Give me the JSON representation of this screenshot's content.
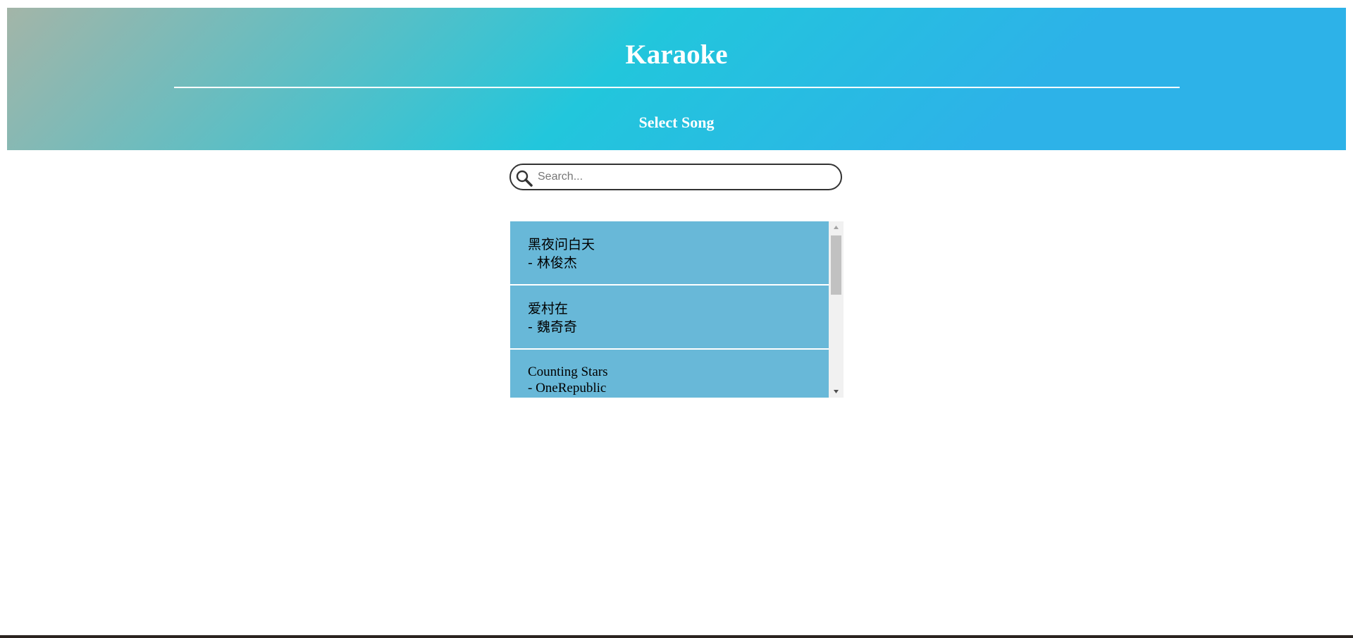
{
  "header": {
    "title": "Karaoke",
    "subtitle": "Select Song"
  },
  "search": {
    "icon": "search-icon",
    "placeholder": "Search...",
    "value": ""
  },
  "songs": [
    {
      "title": "黑夜问白天",
      "artist": "- 林俊杰"
    },
    {
      "title": "爱村在",
      "artist": "- 魏奇奇"
    },
    {
      "title": "Counting Stars",
      "artist": "- OneRepublic"
    }
  ],
  "colors": {
    "header_gradient_start": "#a3b5a8",
    "header_gradient_mid": "#22c6dc",
    "header_gradient_end": "#2db2e8",
    "song_item_bg": "#68b8d8",
    "scrollbar_track": "#f1f1f1",
    "scrollbar_thumb": "#c1c1c1"
  }
}
